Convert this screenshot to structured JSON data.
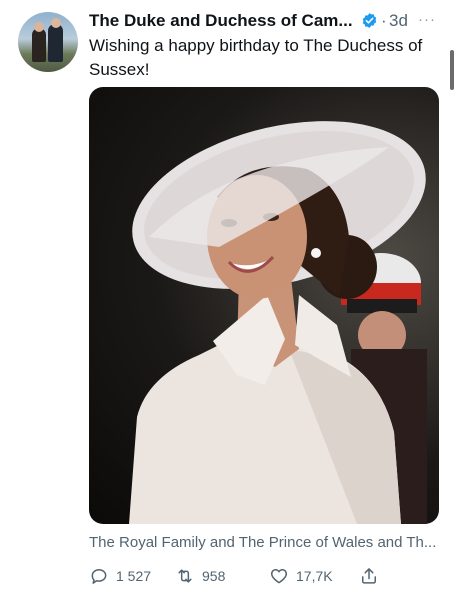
{
  "tweet": {
    "author": "The Duke and Duchess of Cam...",
    "separator": "·",
    "time": "3d",
    "more": "···",
    "text": "Wishing a happy birthday to The Duchess of Sussex!",
    "media_caption": "The Royal Family and The Prince of Wales and Th..."
  },
  "actions": {
    "reply": "1 527",
    "retweet": "958",
    "like": "17,7K"
  },
  "icons": {
    "avatar": "avatar",
    "verified": "verified-badge-icon",
    "more": "more-icon",
    "reply": "reply-icon",
    "retweet": "retweet-icon",
    "like": "heart-icon",
    "share": "share-icon"
  },
  "colors": {
    "text": "#0f1419",
    "secondary": "#536471",
    "verified": "#1d9bf0"
  }
}
